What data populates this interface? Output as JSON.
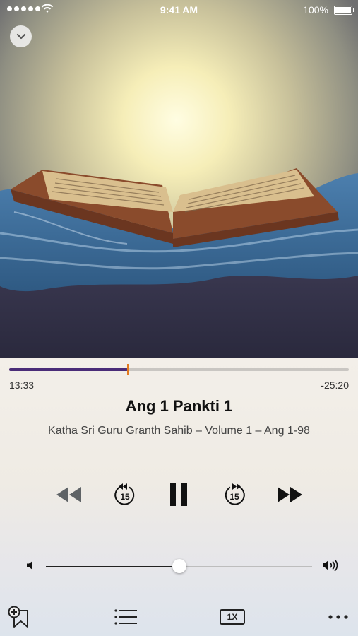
{
  "status_bar": {
    "time": "9:41 AM",
    "battery": "100%"
  },
  "player": {
    "elapsed": "13:33",
    "remaining": "-25:20",
    "progress": 0.349,
    "title": "Ang 1 Pankti 1",
    "subtitle": "Katha Sri Guru Granth Sahib – Volume 1 – Ang 1-98",
    "volume": 0.5
  },
  "controls": {
    "rewind_icon": "rewind-icon",
    "skip_back_icon": "skip-back-15-icon",
    "skip_back_label": "15",
    "pause_icon": "pause-icon",
    "skip_forward_icon": "skip-forward-15-icon",
    "skip_forward_label": "15",
    "fast_forward_icon": "fast-forward-icon"
  },
  "toolbar": {
    "bookmark_icon": "add-bookmark-icon",
    "list_icon": "list-icon",
    "speed_label": "1X",
    "more_icon": "more-icon"
  },
  "colors": {
    "progress_fill": "#4a2c78",
    "progress_thumb": "#e37a1f",
    "artwork_background": "#2a2a40"
  }
}
